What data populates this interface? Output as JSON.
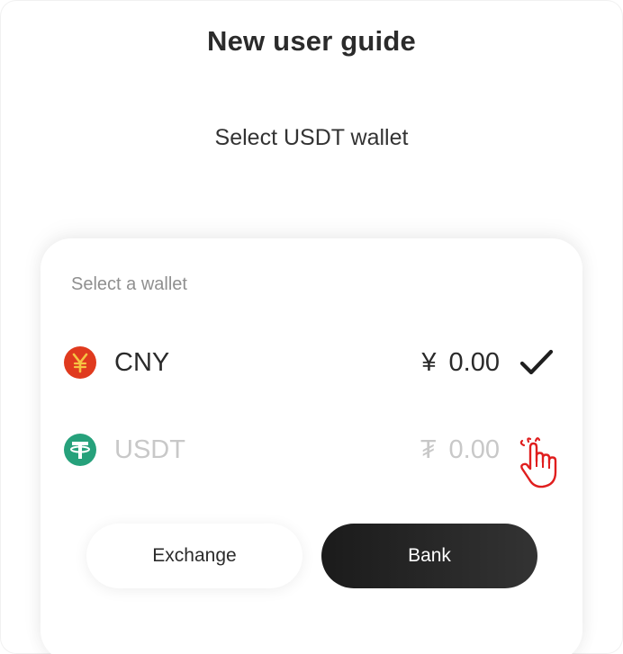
{
  "header": {
    "title": "New user guide",
    "subtitle": "Select USDT wallet"
  },
  "wallet_card": {
    "heading": "Select a wallet",
    "rows": [
      {
        "name": "CNY",
        "symbol": "¥",
        "amount": "0.00",
        "icon": "yuan-coin-icon",
        "icon_color": "#e03a1e",
        "selected": true
      },
      {
        "name": "USDT",
        "symbol": "₮",
        "amount": "0.00",
        "icon": "tether-coin-icon",
        "icon_color": "#26a17b",
        "selected": false
      }
    ],
    "selected_indicator": "checkmark-icon",
    "pointer_hint": "pointing-hand-icon"
  },
  "buttons": {
    "exchange_label": "Exchange",
    "bank_label": "Bank"
  },
  "colors": {
    "text_primary": "#2b2b2b",
    "text_muted": "#8f8f8f",
    "text_disabled": "#c8c8c8",
    "bank_button_bg": "#222222",
    "hand_hint": "#e01e1e"
  }
}
